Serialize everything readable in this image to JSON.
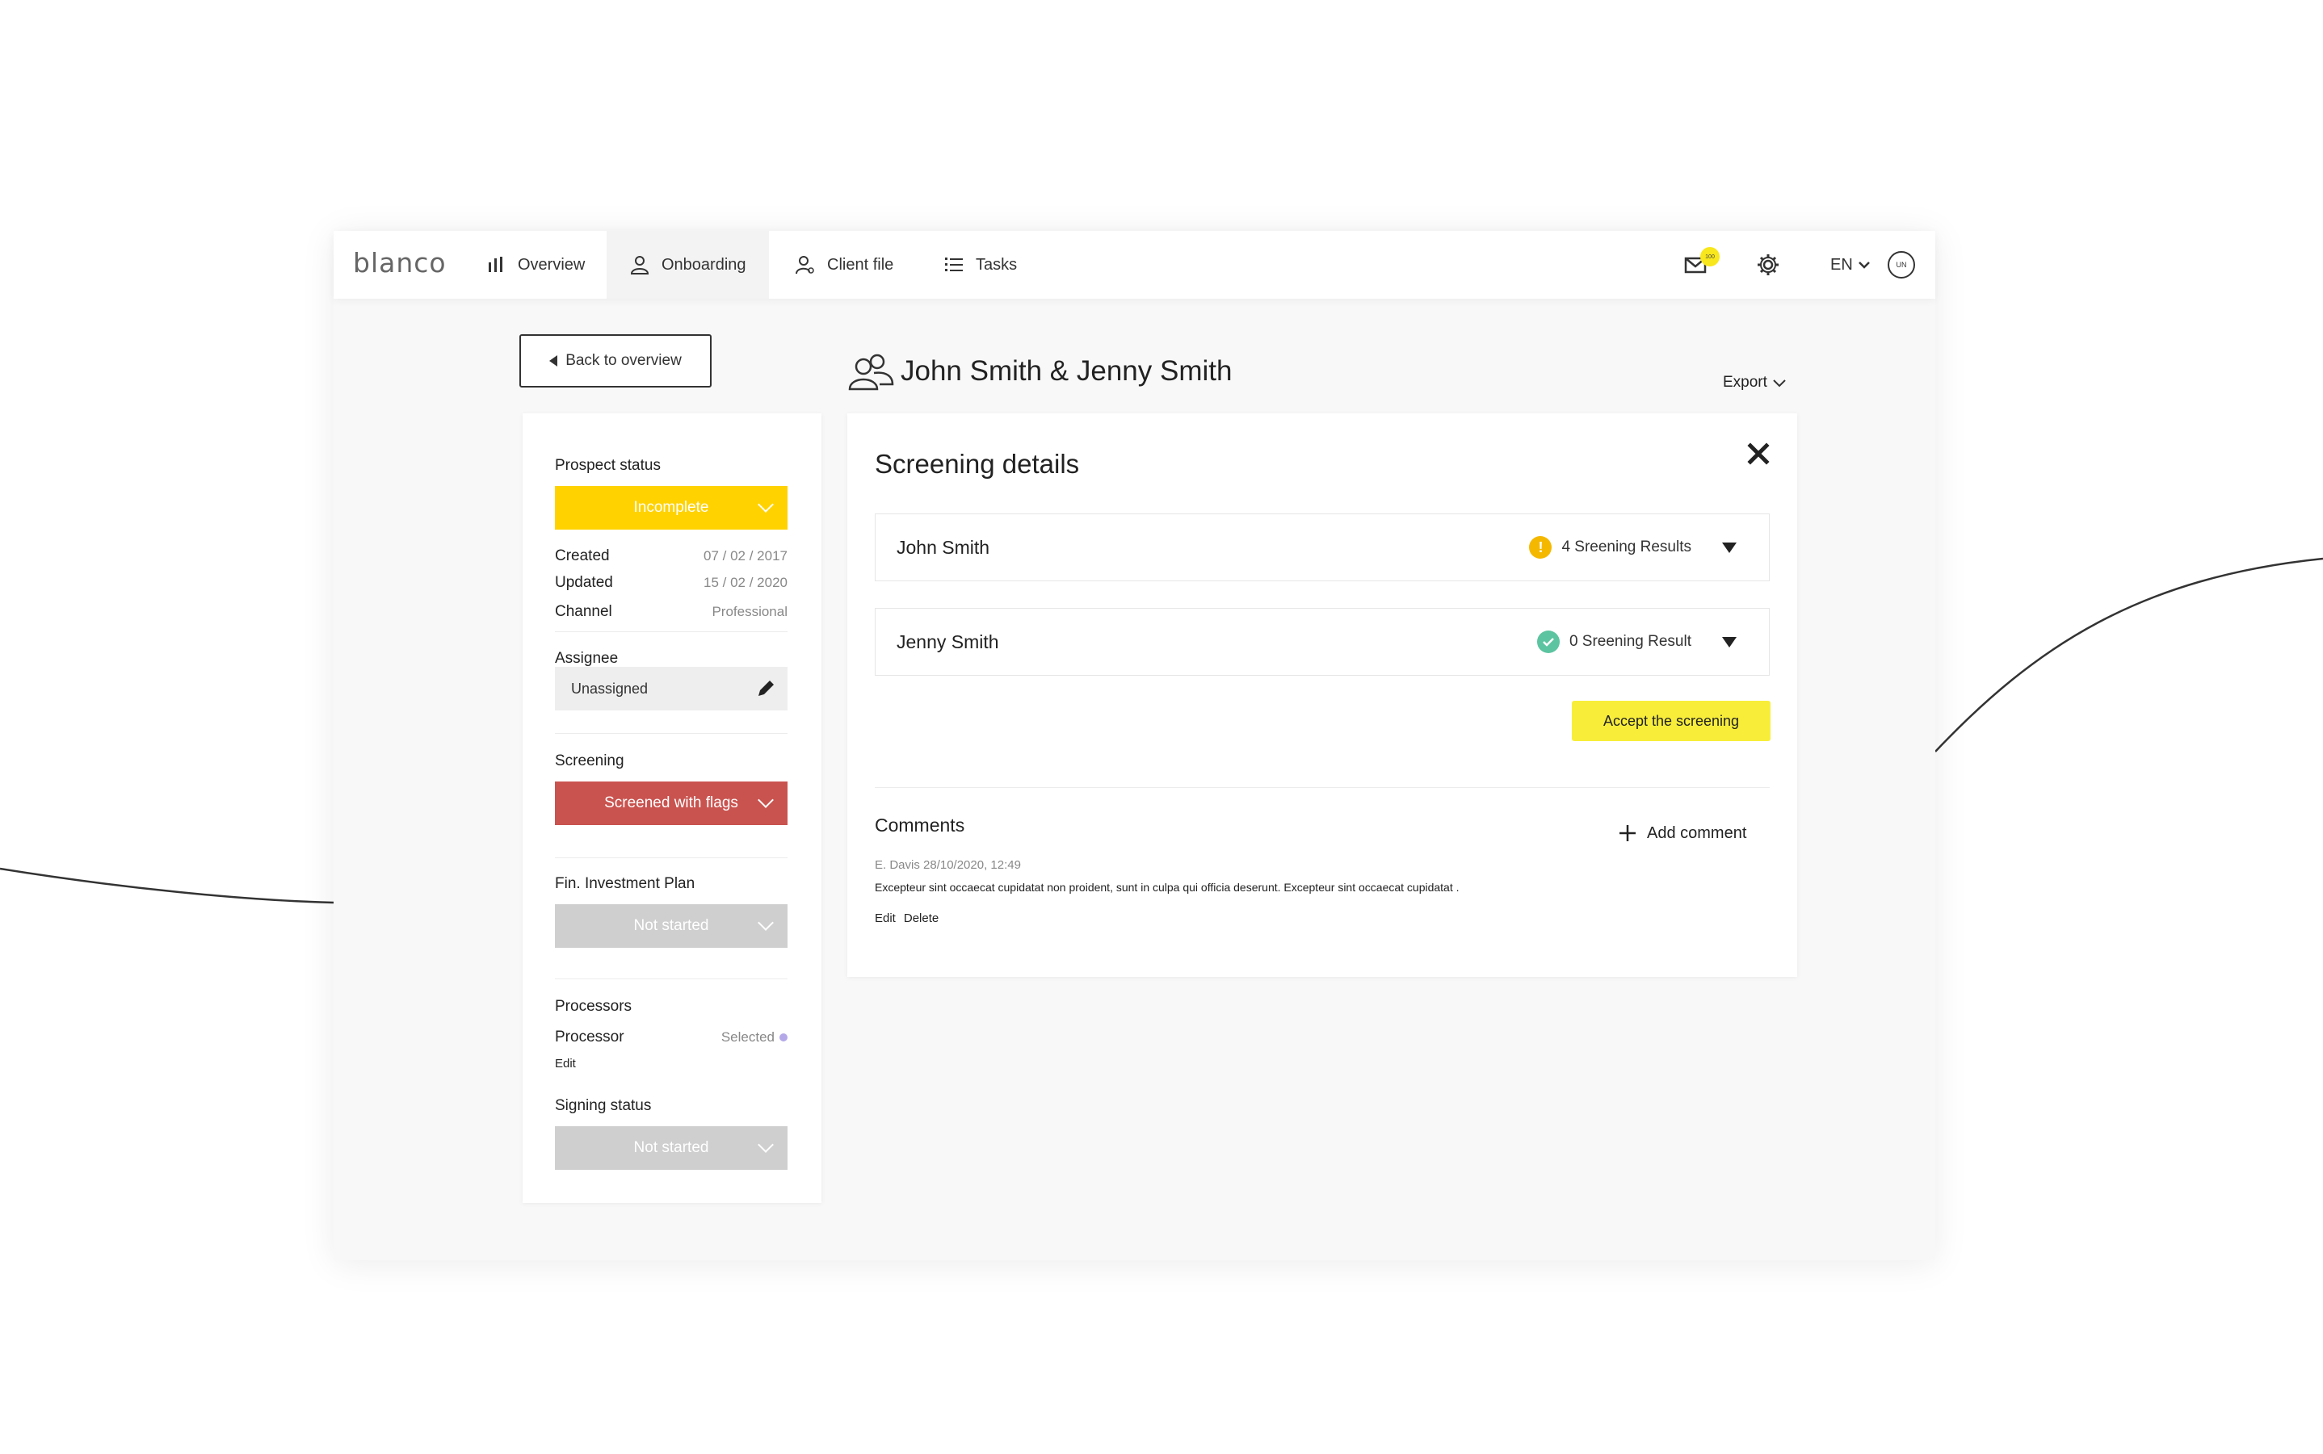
{
  "app": {
    "logo": "blanco"
  },
  "nav": {
    "items": [
      {
        "label": "Overview",
        "icon": "bar-chart-icon"
      },
      {
        "label": "Onboarding",
        "icon": "user-icon"
      },
      {
        "label": "Client file",
        "icon": "user-settings-icon"
      },
      {
        "label": "Tasks",
        "icon": "list-icon"
      }
    ],
    "active": "Onboarding",
    "mail_badge": "100",
    "language": "EN",
    "user_initials": "UN"
  },
  "header": {
    "back_label": "Back to overview",
    "title": "John Smith & Jenny Smith",
    "export_label": "Export"
  },
  "sidebar": {
    "prospect_status": {
      "label": "Prospect status",
      "value": "Incomplete"
    },
    "meta": [
      {
        "key": "Created",
        "value": "07 / 02 / 2017"
      },
      {
        "key": "Updated",
        "value": "15 / 02 / 2020"
      },
      {
        "key": "Channel",
        "value": "Professional"
      }
    ],
    "assignee": {
      "label": "Assignee",
      "value": "Unassigned"
    },
    "screening": {
      "label": "Screening",
      "value": "Screened with flags"
    },
    "investment_plan": {
      "label": "Fin. Investment Plan",
      "value": "Not started"
    },
    "processors": {
      "label": "Processors",
      "name": "Processor",
      "status": "Selected",
      "edit": "Edit"
    },
    "signing_status": {
      "label": "Signing status",
      "value": "Not started"
    }
  },
  "screening_details": {
    "title": "Screening details",
    "rows": [
      {
        "name": "John Smith",
        "result": "4 Sreening Results",
        "status": "warning"
      },
      {
        "name": "Jenny Smith",
        "result": "0 Sreening Result",
        "status": "ok"
      }
    ],
    "accept_label": "Accept the screening"
  },
  "comments": {
    "title": "Comments",
    "add_label": "Add comment",
    "items": [
      {
        "author_time": "E. Davis 28/10/2020, 12:49",
        "text": "Excepteur sint occaecat cupidatat non proident, sunt in culpa qui officia deserunt. Excepteur sint occaecat cupidatat .",
        "edit": "Edit",
        "delete": "Delete"
      }
    ]
  },
  "colors": {
    "incomplete": "#ffd200",
    "flagged": "#c9534f",
    "not_started": "#cfcfcf",
    "accept": "#f8ee3a",
    "warning": "#f5b800",
    "ok": "#5cc4a0"
  }
}
